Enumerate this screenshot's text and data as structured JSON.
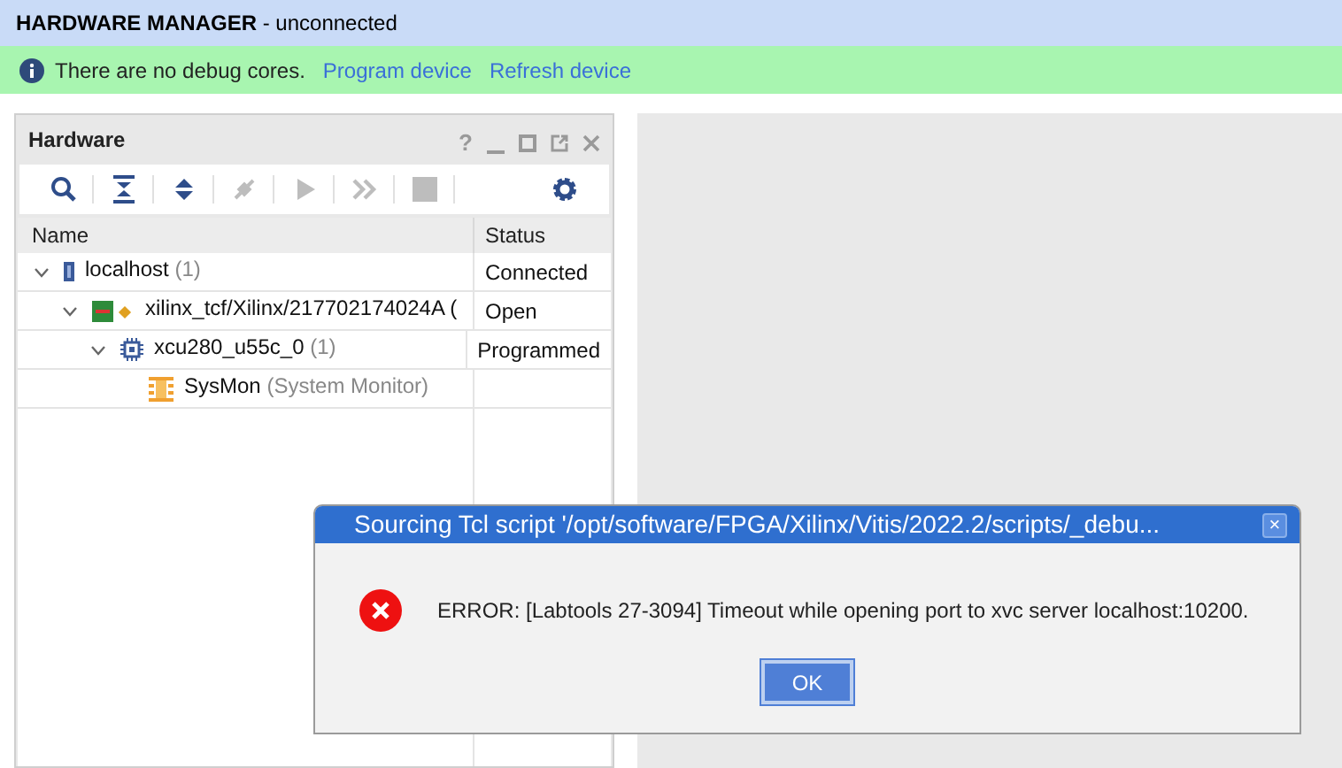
{
  "header": {
    "title": "HARDWARE MANAGER",
    "subtitle": "- unconnected"
  },
  "banner": {
    "message": "There are no debug cores.",
    "links": [
      "Program device",
      "Refresh device"
    ]
  },
  "panel": {
    "title": "Hardware",
    "window_controls": [
      "?"
    ],
    "toolbar": [
      {
        "kind": "search",
        "disabled": false
      },
      {
        "kind": "collapse",
        "disabled": false
      },
      {
        "kind": "expand",
        "disabled": false
      },
      {
        "kind": "connect",
        "disabled": true
      },
      {
        "kind": "run",
        "disabled": true
      },
      {
        "kind": "step",
        "disabled": true
      },
      {
        "kind": "stop",
        "disabled": true
      },
      {
        "kind": "settings",
        "disabled": false
      }
    ],
    "columns": [
      "Name",
      "Status"
    ],
    "tree": [
      {
        "kind": "host",
        "name": "localhost",
        "count": "(1)",
        "status": "Connected",
        "expanded": true,
        "children": [
          {
            "kind": "target",
            "name": "xilinx_tcf/Xilinx/217702174024A (",
            "status": "Open",
            "expanded": true,
            "children": [
              {
                "kind": "chip",
                "name": "xcu280_u55c_0",
                "count": "(1)",
                "status": "Programmed",
                "expanded": true,
                "children": [
                  {
                    "kind": "sysmon",
                    "name": "SysMon",
                    "count": "(System Monitor)"
                  }
                ]
              }
            ]
          }
        ]
      }
    ]
  },
  "dialog": {
    "title": "Sourcing Tcl script '/opt/software/FPGA/Xilinx/Vitis/2022.2/scripts/_debu...",
    "close": "×",
    "message": "ERROR: [Labtools 27-3094] Timeout while opening port to xvc server localhost:10200.",
    "button": "OK"
  }
}
